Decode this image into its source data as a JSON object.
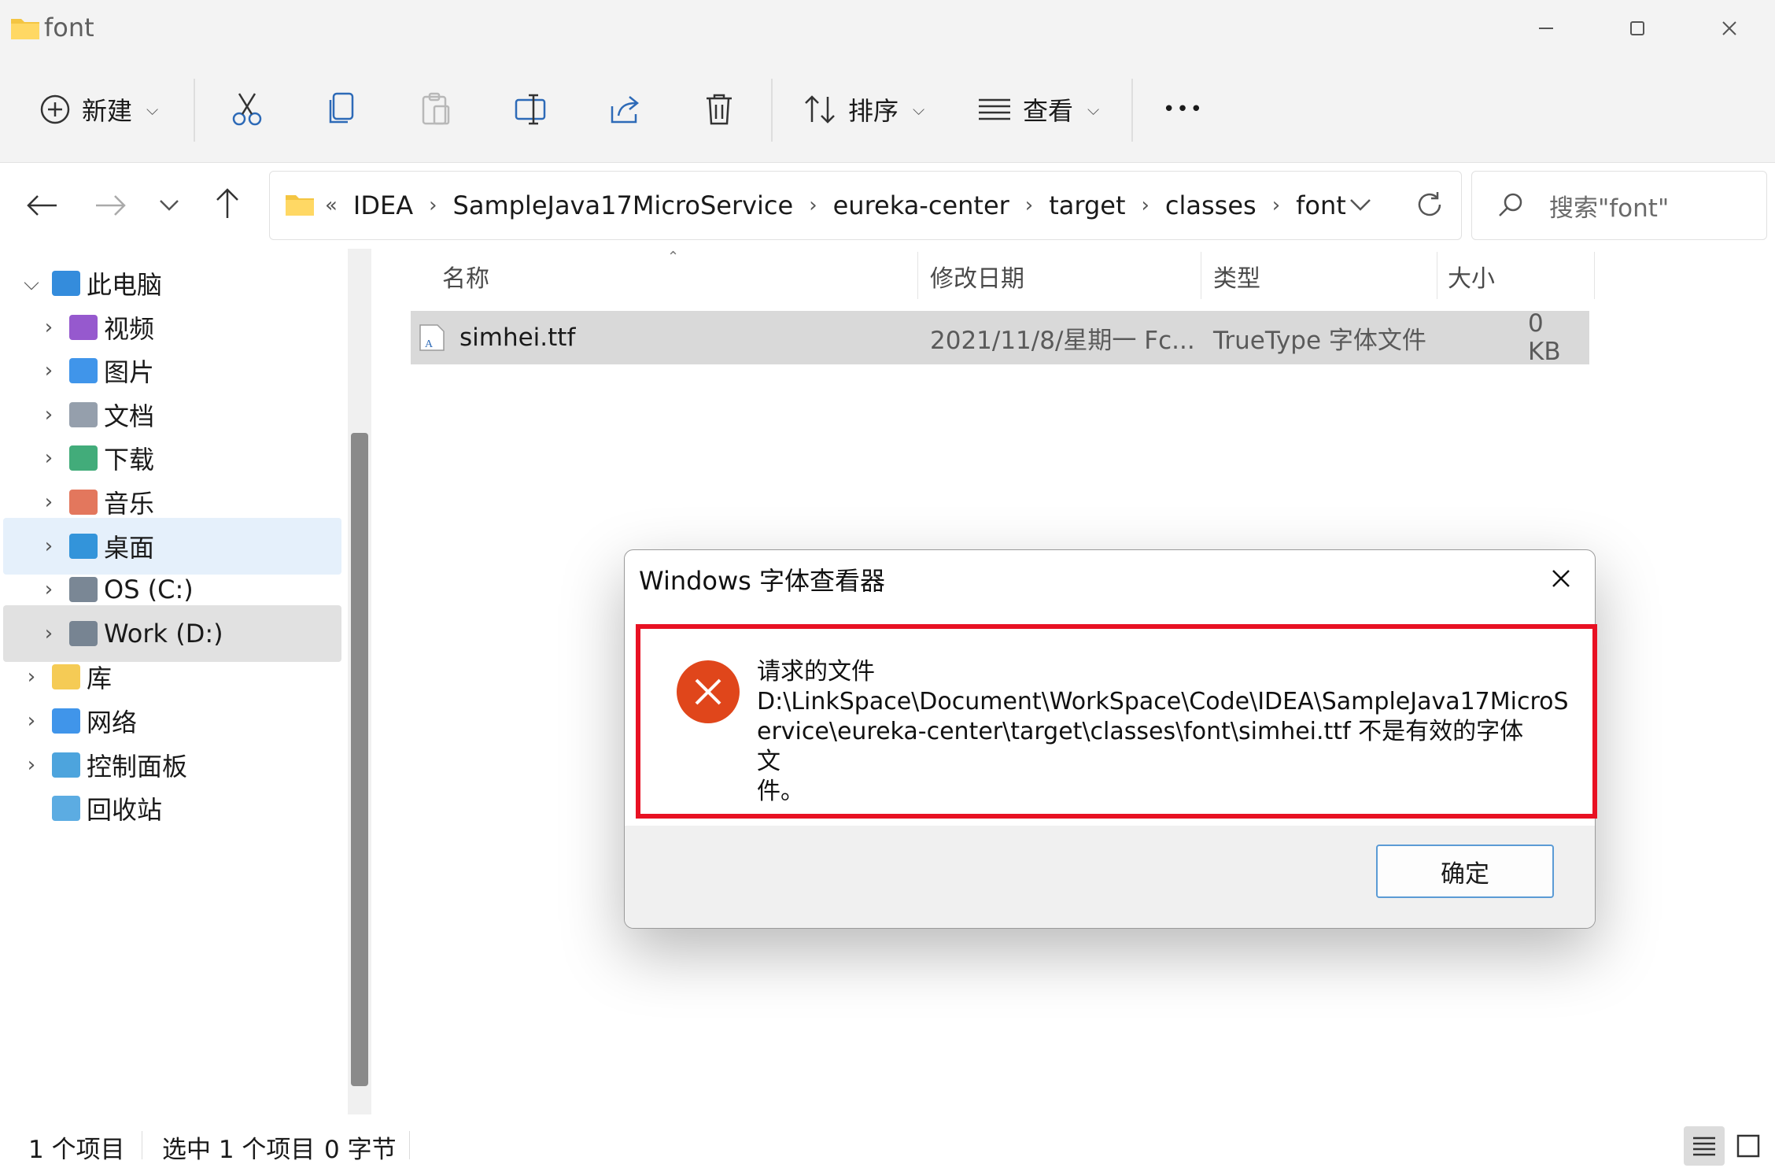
{
  "window": {
    "title": "font",
    "minimize_icon": "minimize-icon",
    "maximize_icon": "maximize-icon",
    "close_icon": "close-icon"
  },
  "toolbar": {
    "new_label": "新建",
    "sort_label": "排序",
    "view_label": "查看",
    "more_label": "•••",
    "icons": [
      "cut-icon",
      "copy-icon",
      "paste-icon",
      "rename-icon",
      "share-icon",
      "delete-icon"
    ]
  },
  "address": {
    "overflow": "«",
    "crumbs": [
      "IDEA",
      "SampleJava17MicroService",
      "eureka-center",
      "target",
      "classes",
      "font"
    ],
    "search_placeholder": "搜索\"font\""
  },
  "sidebar": {
    "items": [
      {
        "label": "此电脑",
        "icon": "this-pc-icon",
        "level": 0,
        "expanded": true
      },
      {
        "label": "视频",
        "icon": "videos-folder-icon",
        "level": 1
      },
      {
        "label": "图片",
        "icon": "pictures-folder-icon",
        "level": 1
      },
      {
        "label": "文档",
        "icon": "documents-folder-icon",
        "level": 1
      },
      {
        "label": "下载",
        "icon": "downloads-folder-icon",
        "level": 1
      },
      {
        "label": "音乐",
        "icon": "music-folder-icon",
        "level": 1
      },
      {
        "label": "桌面",
        "icon": "desktop-folder-icon",
        "level": 1,
        "state": "hover"
      },
      {
        "label": "OS (C:)",
        "icon": "drive-c-icon",
        "level": 1
      },
      {
        "label": "Work (D:)",
        "icon": "drive-d-icon",
        "level": 1,
        "state": "selected"
      },
      {
        "label": "库",
        "icon": "libraries-icon",
        "level": 0
      },
      {
        "label": "网络",
        "icon": "network-icon",
        "level": 0
      },
      {
        "label": "控制面板",
        "icon": "control-panel-icon",
        "level": 0
      },
      {
        "label": "回收站",
        "icon": "recycle-bin-icon",
        "level": 0
      }
    ]
  },
  "columns": {
    "name": "名称",
    "date": "修改日期",
    "type": "类型",
    "size": "大小"
  },
  "files": [
    {
      "name": "simhei.ttf",
      "date": "2021/11/8/星期一 Fc...",
      "type": "TrueType 字体文件",
      "size": "0 KB"
    }
  ],
  "status": {
    "count": "1 个项目",
    "selected": "选中 1 个项目",
    "bytes": "0 字节"
  },
  "dialog": {
    "title": "Windows 字体查看器",
    "message_lines": [
      "请求的文件",
      "D:\\LinkSpace\\Document\\WorkSpace\\Code\\IDEA\\SampleJava17MicroS",
      "ervice\\eureka-center\\target\\classes\\font\\simhei.ttf 不是有效的字体文",
      "件。"
    ],
    "ok_label": "确定",
    "error_color": "#e0461b",
    "highlight_color": "#e81123"
  }
}
